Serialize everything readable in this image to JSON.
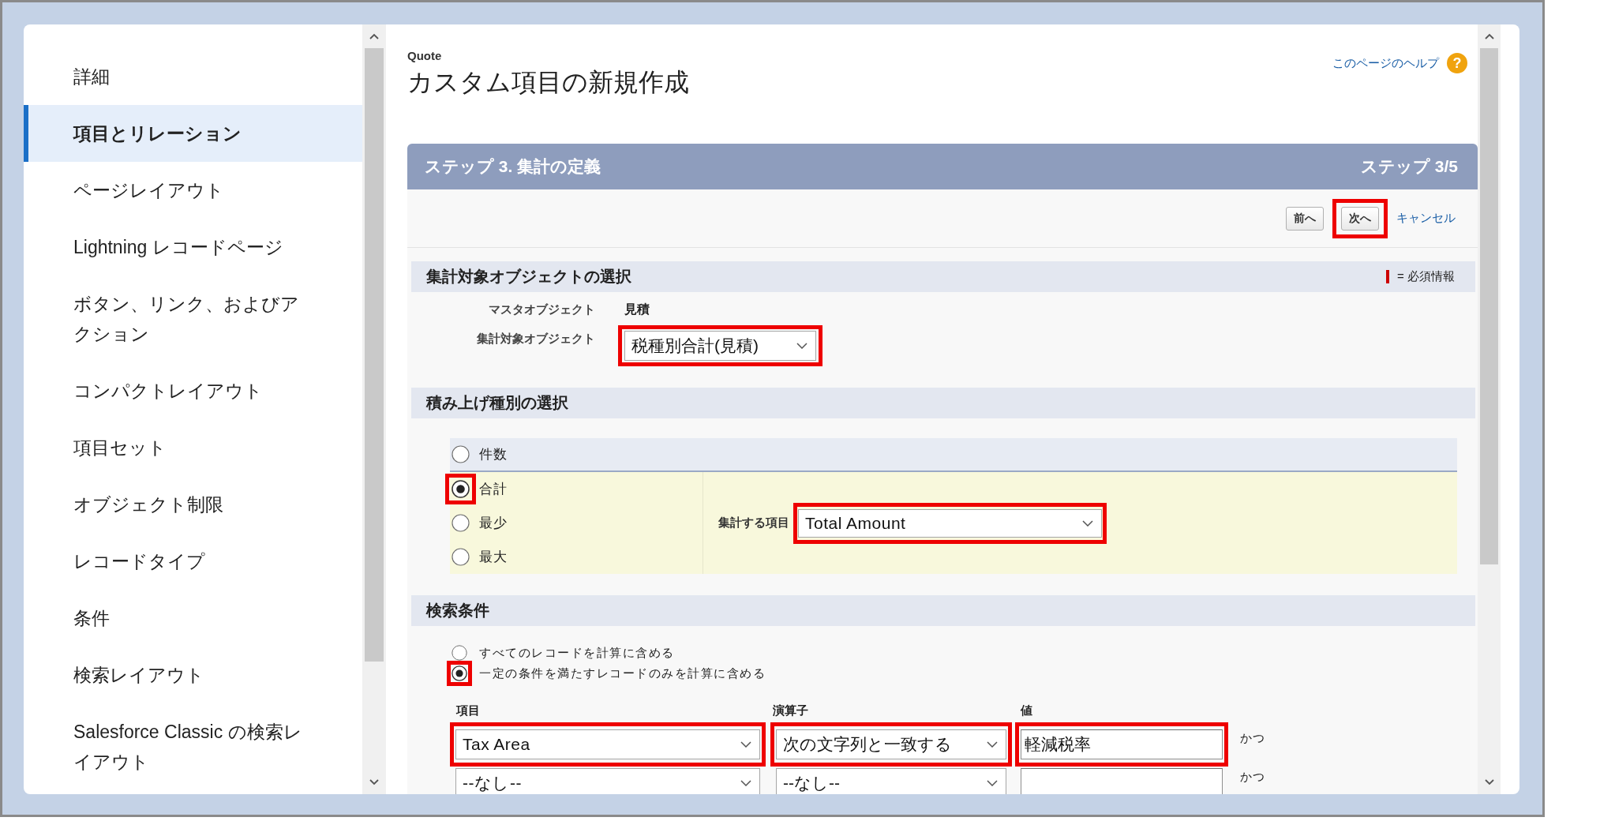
{
  "sidebar": {
    "items": [
      {
        "lines": [
          "詳細"
        ],
        "selected": false
      },
      {
        "lines": [
          "項目とリレーション"
        ],
        "selected": true
      },
      {
        "lines": [
          "ページレイアウト"
        ],
        "selected": false
      },
      {
        "lines": [
          "Lightning レコードページ"
        ],
        "selected": false
      },
      {
        "lines": [
          "ボタン、リンク、およびア",
          "クション"
        ],
        "selected": false
      },
      {
        "lines": [
          "コンパクトレイアウト"
        ],
        "selected": false
      },
      {
        "lines": [
          "項目セット"
        ],
        "selected": false
      },
      {
        "lines": [
          "オブジェクト制限"
        ],
        "selected": false
      },
      {
        "lines": [
          "レコードタイプ"
        ],
        "selected": false
      },
      {
        "lines": [
          "条件"
        ],
        "selected": false
      },
      {
        "lines": [
          "検索レイアウト"
        ],
        "selected": false
      },
      {
        "lines": [
          "Salesforce Classic の検索レ",
          "イアウト"
        ],
        "selected": false
      }
    ]
  },
  "header": {
    "object_name": "Quote",
    "title": "カスタム項目の新規作成",
    "help_link": "このページのヘルプ",
    "help_icon": "?"
  },
  "step_bar": {
    "title": "ステップ 3. 集計の定義",
    "counter": "ステップ 3/5"
  },
  "actions": [
    {
      "kind": "button",
      "label": "前へ",
      "highlighted": false
    },
    {
      "kind": "button",
      "label": "次へ",
      "highlighted": true
    },
    {
      "kind": "link",
      "label": "キャンセル",
      "highlighted": false
    }
  ],
  "object_section": {
    "title": "集計対象オブジェクトの選択",
    "required_legend": "= 必須情報",
    "fields": [
      {
        "kind": "text",
        "label": "マスタオブジェクト",
        "value": "見積",
        "highlighted": false
      },
      {
        "kind": "select",
        "label": "集計対象オブジェクト",
        "value": "税種別合計(見積)",
        "highlighted": true
      }
    ]
  },
  "rollup_section": {
    "title": "積み上げ種別の選択",
    "options": [
      {
        "kind": "count",
        "label": "件数",
        "selected": false,
        "highlighted": false
      },
      {
        "kind": "aggregate",
        "label": "合計",
        "selected": true,
        "highlighted": true
      },
      {
        "kind": "aggregate",
        "label": "最少",
        "selected": false,
        "highlighted": false
      },
      {
        "kind": "aggregate",
        "label": "最大",
        "selected": false,
        "highlighted": false
      }
    ],
    "field_label": "集計する項目",
    "field": {
      "value": "Total Amount",
      "highlighted": true
    }
  },
  "filter_section": {
    "title": "検索条件",
    "modes": [
      {
        "label": "すべてのレコードを計算に含める",
        "selected": false,
        "highlighted": false
      },
      {
        "label": "一定の条件を満たすレコードのみを計算に含める",
        "selected": true,
        "highlighted": true
      }
    ],
    "columns": [
      "項目",
      "演算子",
      "値"
    ],
    "rows": [
      {
        "field": {
          "value": "Tax Area",
          "highlighted": true
        },
        "operator": {
          "value": "次の文字列と一致する",
          "highlighted": true
        },
        "value": {
          "value": "軽減税率",
          "highlighted": true
        },
        "conjunction": "かつ"
      },
      {
        "field": {
          "value": "--なし--",
          "highlighted": false
        },
        "operator": {
          "value": "--なし--",
          "highlighted": false
        },
        "value": {
          "highlighted": false
        },
        "conjunction": "かつ"
      }
    ]
  }
}
